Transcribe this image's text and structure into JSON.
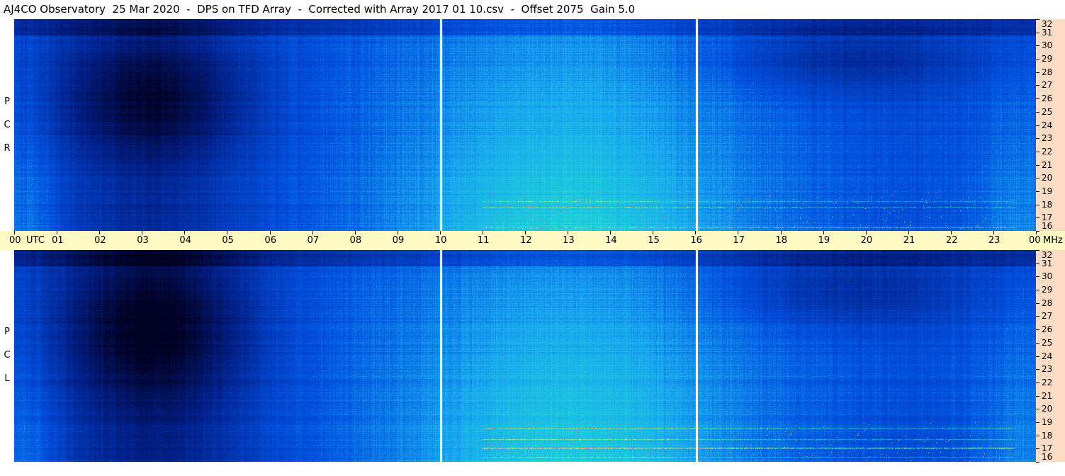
{
  "title": "AJ4CO Observatory  25 Mar 2020  -  DPS on TFD Array  -  Corrected with Array 2017 01 10.csv  -  Offset 2075  Gain 5.0",
  "chart_data": {
    "type": "heatmap",
    "title": "AJ4CO Observatory  25 Mar 2020  -  DPS on TFD Array  -  Corrected with Array 2017 01 10.csv  -  Offset 2075  Gain 5.0",
    "x_axis": {
      "unit_label": "UTC",
      "range": [
        0,
        24
      ],
      "tick_labels": [
        "00",
        "01",
        "02",
        "03",
        "04",
        "05",
        "06",
        "07",
        "08",
        "09",
        "10",
        "11",
        "12",
        "13",
        "14",
        "15",
        "16",
        "17",
        "18",
        "19",
        "20",
        "21",
        "22",
        "23",
        "00"
      ]
    },
    "y_axis": {
      "unit_label": "MHz",
      "range": [
        16,
        32
      ],
      "tick_labels": [
        "32",
        "31",
        "30",
        "29",
        "28",
        "27",
        "26",
        "25",
        "24",
        "23",
        "22",
        "21",
        "20",
        "19",
        "18",
        "17",
        "16"
      ]
    },
    "panels": [
      {
        "label": "RCP",
        "letters": [
          "R",
          "C",
          "P"
        ]
      },
      {
        "label": "LCP",
        "letters": [
          "L",
          "C",
          "P"
        ]
      }
    ],
    "gaps_utc": [
      10.0,
      16.0
    ],
    "colormap": [
      "#000020",
      "#00208a",
      "#0050e0",
      "#1aa8f0",
      "#20e0d0",
      "#e0f040",
      "#ff40a0"
    ]
  }
}
